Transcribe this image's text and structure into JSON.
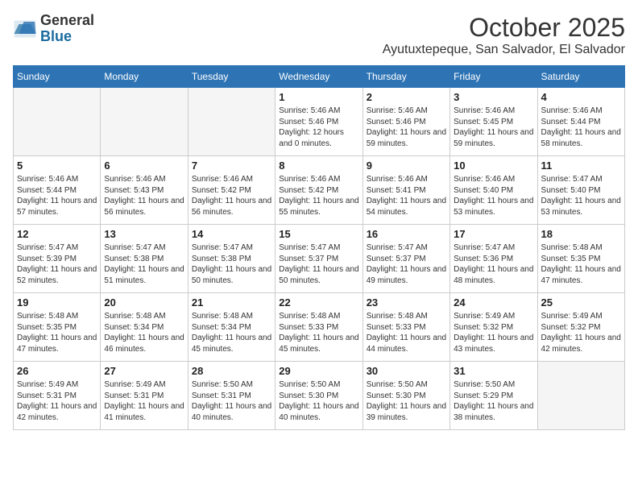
{
  "header": {
    "logo_line1": "General",
    "logo_line2": "Blue",
    "month": "October 2025",
    "location": "Ayutuxtepeque, San Salvador, El Salvador"
  },
  "weekdays": [
    "Sunday",
    "Monday",
    "Tuesday",
    "Wednesday",
    "Thursday",
    "Friday",
    "Saturday"
  ],
  "weeks": [
    [
      {
        "day": "",
        "empty": true
      },
      {
        "day": "",
        "empty": true
      },
      {
        "day": "",
        "empty": true
      },
      {
        "day": "1",
        "sunrise": "5:46 AM",
        "sunset": "5:46 PM",
        "daylight": "12 hours and 0 minutes."
      },
      {
        "day": "2",
        "sunrise": "5:46 AM",
        "sunset": "5:46 PM",
        "daylight": "11 hours and 59 minutes."
      },
      {
        "day": "3",
        "sunrise": "5:46 AM",
        "sunset": "5:45 PM",
        "daylight": "11 hours and 59 minutes."
      },
      {
        "day": "4",
        "sunrise": "5:46 AM",
        "sunset": "5:44 PM",
        "daylight": "11 hours and 58 minutes."
      }
    ],
    [
      {
        "day": "5",
        "sunrise": "5:46 AM",
        "sunset": "5:44 PM",
        "daylight": "11 hours and 57 minutes."
      },
      {
        "day": "6",
        "sunrise": "5:46 AM",
        "sunset": "5:43 PM",
        "daylight": "11 hours and 56 minutes."
      },
      {
        "day": "7",
        "sunrise": "5:46 AM",
        "sunset": "5:42 PM",
        "daylight": "11 hours and 56 minutes."
      },
      {
        "day": "8",
        "sunrise": "5:46 AM",
        "sunset": "5:42 PM",
        "daylight": "11 hours and 55 minutes."
      },
      {
        "day": "9",
        "sunrise": "5:46 AM",
        "sunset": "5:41 PM",
        "daylight": "11 hours and 54 minutes."
      },
      {
        "day": "10",
        "sunrise": "5:46 AM",
        "sunset": "5:40 PM",
        "daylight": "11 hours and 53 minutes."
      },
      {
        "day": "11",
        "sunrise": "5:47 AM",
        "sunset": "5:40 PM",
        "daylight": "11 hours and 53 minutes."
      }
    ],
    [
      {
        "day": "12",
        "sunrise": "5:47 AM",
        "sunset": "5:39 PM",
        "daylight": "11 hours and 52 minutes."
      },
      {
        "day": "13",
        "sunrise": "5:47 AM",
        "sunset": "5:38 PM",
        "daylight": "11 hours and 51 minutes."
      },
      {
        "day": "14",
        "sunrise": "5:47 AM",
        "sunset": "5:38 PM",
        "daylight": "11 hours and 50 minutes."
      },
      {
        "day": "15",
        "sunrise": "5:47 AM",
        "sunset": "5:37 PM",
        "daylight": "11 hours and 50 minutes."
      },
      {
        "day": "16",
        "sunrise": "5:47 AM",
        "sunset": "5:37 PM",
        "daylight": "11 hours and 49 minutes."
      },
      {
        "day": "17",
        "sunrise": "5:47 AM",
        "sunset": "5:36 PM",
        "daylight": "11 hours and 48 minutes."
      },
      {
        "day": "18",
        "sunrise": "5:48 AM",
        "sunset": "5:35 PM",
        "daylight": "11 hours and 47 minutes."
      }
    ],
    [
      {
        "day": "19",
        "sunrise": "5:48 AM",
        "sunset": "5:35 PM",
        "daylight": "11 hours and 47 minutes."
      },
      {
        "day": "20",
        "sunrise": "5:48 AM",
        "sunset": "5:34 PM",
        "daylight": "11 hours and 46 minutes."
      },
      {
        "day": "21",
        "sunrise": "5:48 AM",
        "sunset": "5:34 PM",
        "daylight": "11 hours and 45 minutes."
      },
      {
        "day": "22",
        "sunrise": "5:48 AM",
        "sunset": "5:33 PM",
        "daylight": "11 hours and 45 minutes."
      },
      {
        "day": "23",
        "sunrise": "5:48 AM",
        "sunset": "5:33 PM",
        "daylight": "11 hours and 44 minutes."
      },
      {
        "day": "24",
        "sunrise": "5:49 AM",
        "sunset": "5:32 PM",
        "daylight": "11 hours and 43 minutes."
      },
      {
        "day": "25",
        "sunrise": "5:49 AM",
        "sunset": "5:32 PM",
        "daylight": "11 hours and 42 minutes."
      }
    ],
    [
      {
        "day": "26",
        "sunrise": "5:49 AM",
        "sunset": "5:31 PM",
        "daylight": "11 hours and 42 minutes."
      },
      {
        "day": "27",
        "sunrise": "5:49 AM",
        "sunset": "5:31 PM",
        "daylight": "11 hours and 41 minutes."
      },
      {
        "day": "28",
        "sunrise": "5:50 AM",
        "sunset": "5:31 PM",
        "daylight": "11 hours and 40 minutes."
      },
      {
        "day": "29",
        "sunrise": "5:50 AM",
        "sunset": "5:30 PM",
        "daylight": "11 hours and 40 minutes."
      },
      {
        "day": "30",
        "sunrise": "5:50 AM",
        "sunset": "5:30 PM",
        "daylight": "11 hours and 39 minutes."
      },
      {
        "day": "31",
        "sunrise": "5:50 AM",
        "sunset": "5:29 PM",
        "daylight": "11 hours and 38 minutes."
      },
      {
        "day": "",
        "empty": true
      }
    ]
  ],
  "labels": {
    "sunrise": "Sunrise:",
    "sunset": "Sunset:",
    "daylight": "Daylight:"
  }
}
